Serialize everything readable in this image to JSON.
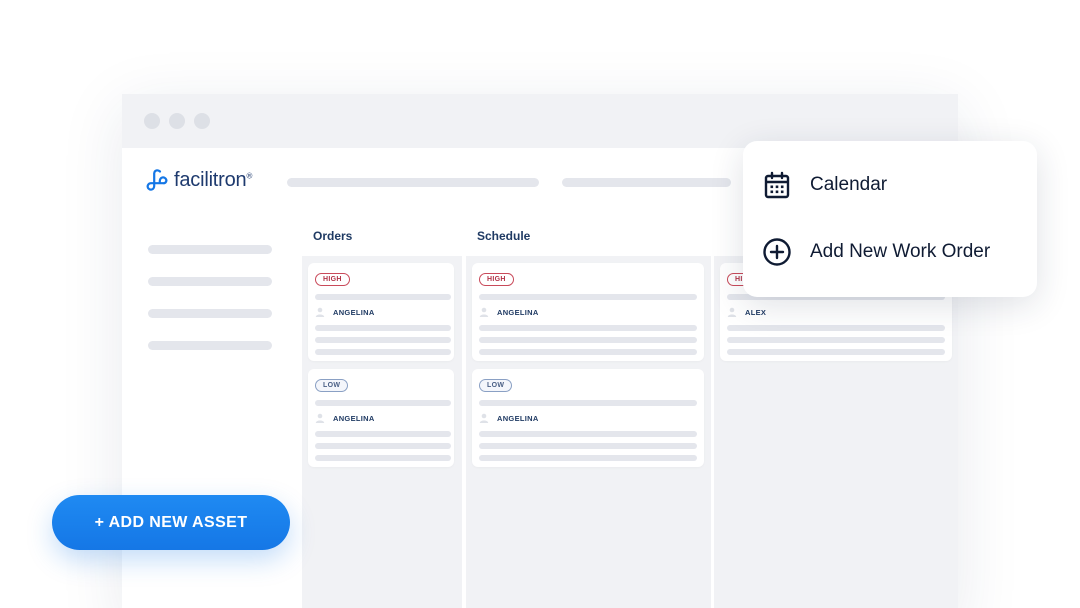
{
  "brand": {
    "name": "facilitron",
    "trademark": "®",
    "color": "#1e3a6e",
    "accent": "#1577e6"
  },
  "board": {
    "columns": [
      {
        "title": "Orders",
        "cards": [
          {
            "priority": "HIGH",
            "assignee": "ANGELINA"
          },
          {
            "priority": "LOW",
            "assignee": "ANGELINA"
          }
        ]
      },
      {
        "title": "Schedule",
        "cards": [
          {
            "priority": "HIGH",
            "assignee": "ANGELINA"
          },
          {
            "priority": "LOW",
            "assignee": "ANGELINA"
          }
        ]
      },
      {
        "title": "",
        "cards": [
          {
            "priority": "HI",
            "assignee": "ALEX"
          }
        ]
      }
    ]
  },
  "menu": {
    "items": [
      {
        "label": "Calendar",
        "icon": "calendar-icon"
      },
      {
        "label": "Add New Work Order",
        "icon": "plus-circle-icon"
      }
    ]
  },
  "actions": {
    "add_asset_label": "+ ADD NEW ASSET"
  },
  "colors": {
    "priority_high": "#b13246",
    "priority_low": "#4a5f85",
    "skeleton": "#e4e6ec",
    "column_bg": "#f1f2f5"
  }
}
